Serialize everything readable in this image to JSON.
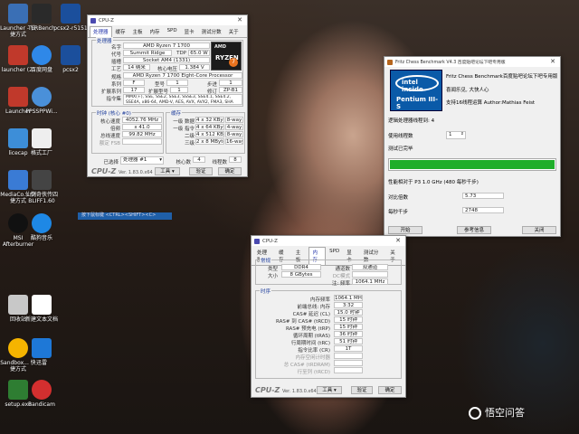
{
  "desktop": {
    "icons": [
      {
        "label": "Launcher - 快捷方式",
        "color": "#3a6fb5"
      },
      {
        "label": "TLRBench",
        "color": "#2a2a2a"
      },
      {
        "label": "pcsx2-r5151",
        "color": "#1b4f9c"
      },
      {
        "label": "launcher (2)",
        "color": "#c0392b"
      },
      {
        "label": "百度网盘",
        "color": "#2f88e8"
      },
      {
        "label": "pcsx2",
        "color": "#1b4f9c"
      },
      {
        "label": "Launcher",
        "color": "#c0392b"
      },
      {
        "label": "PPSSPPWi...",
        "color": "#4a90d9"
      },
      {
        "label": "licecap",
        "color": "#3d8ed8"
      },
      {
        "label": "格式工厂",
        "color": "#eeeeee"
      },
      {
        "label": "MediaCo... 快捷方式",
        "color": "#3a7bd5"
      },
      {
        "label": "仙剑奇侠传四 BLIFF1.60",
        "color": "#444"
      },
      {
        "label": "MSI Afterburner",
        "color": "#111"
      },
      {
        "label": "酷狗音乐",
        "color": "#1e88e5"
      },
      {
        "label": "回收站",
        "color": "#c8c8c8"
      },
      {
        "label": "新建文本文档",
        "color": "#ffffff"
      },
      {
        "label": "Sandbox... 快捷方式",
        "color": "#f5b400"
      },
      {
        "label": "迅雷",
        "color": "#1e78d7"
      },
      {
        "label": "setup.exe",
        "color": "#2e7d32"
      },
      {
        "label": "Bandicam",
        "color": "#d32f2f"
      }
    ]
  },
  "hint_bar": "按下鼠标键 <CTRL><SHIFT><C>",
  "watermark": "悟空问答",
  "cpuz1": {
    "title": "CPU-Z",
    "tabs": [
      "处理器",
      "缓存",
      "主板",
      "内存",
      "SPD",
      "显卡",
      "测试分数",
      "关于"
    ],
    "group_processor": "处理器",
    "name_label": "名字",
    "name": "AMD Ryzen 7 1700",
    "code_label": "代号",
    "code": "Summit Ridge",
    "tdp_label": "TDP",
    "tdp": "65.0 W",
    "socket_label": "插槽",
    "socket": "Socket AM4 (1331)",
    "tech_label": "工艺",
    "tech": "14 纳米",
    "vcore_label": "核心电压",
    "vcore": "1.384 V",
    "spec_label": "规格",
    "spec": "AMD Ryzen 7 1700 Eight-Core Processor",
    "family_label": "系列",
    "family": "F",
    "model_label": "型号",
    "model": "1",
    "stepping_label": "步进",
    "stepping": "1",
    "extfamily_label": "扩展系列",
    "extfamily": "17",
    "extmodel_label": "扩展型号",
    "extmodel": "1",
    "revision_label": "修订",
    "revision": "ZP-B1",
    "instr_label": "指令集",
    "instr": "MMX(+), SSE, SSE2, SSE3, SSSE3, SSE4.1, SSE4.2, SSE4A, x86-64, AMD-V, AES, AVX, AVX2, FMA3, SHA",
    "group_clocks": "时钟 (核心 #0)",
    "corespeed_label": "核心速度",
    "corespeed": "4052.76 MHz",
    "mult_label": "倍频",
    "mult": "x 41.0",
    "bus_label": "总线速度",
    "bus": "99.82 MHz",
    "fsb_label": "额定 FSB",
    "fsb": "",
    "group_cache": "缓存",
    "cache": [
      {
        "label": "一级 数据",
        "size": "4 x 32 KBytes",
        "way": "8-way"
      },
      {
        "label": "一级 指令",
        "size": "4 x 64 KBytes",
        "way": "4-way"
      },
      {
        "label": "二级",
        "size": "4 x 512 KBytes",
        "way": "8-way"
      },
      {
        "label": "三级",
        "size": "2 x 8 MBytes",
        "way": "16-way"
      }
    ],
    "selected_label": "已选择",
    "selected": "处理器 #1",
    "cores_label": "核心数",
    "cores": "4",
    "threads_label": "线程数",
    "threads": "8",
    "logo": "CPU-Z",
    "version": "Ver. 1.83.0.x64",
    "tools": "工具",
    "validate": "验证",
    "ok": "确定",
    "brand_amd": "AMD",
    "brand_ryzen": "RYZEN",
    "brand_num": "7"
  },
  "fritz": {
    "title": "Fritz Chess Benchmark V4.3   百度贴吧论坛下吧专用版",
    "header_line1": "Fritz Chess Benchmark百度贴吧论坛下吧专用版",
    "header_line2": "喜闻乐见, 大快人心",
    "header_line3": "支持16线程运算     Author:Mathias Feist",
    "intel_inside": "intel inside",
    "intel_model": "Pentium III-S",
    "threads_label": "逻辑处理器线程到: 4",
    "use_threads_label": "使用线程数",
    "use_threads_value": "1",
    "test_done": "测试已完毕",
    "progress": 1.0,
    "progress_color": "#1fae2a",
    "perf_label": "性能相对于 P3 1.0 GHz (480 每秒千步)",
    "ratio_label": "对比倍数",
    "ratio": "5.73",
    "kn_label": "每秒千步",
    "kn": "2748",
    "start": "开始",
    "reference": "参考信息",
    "close": "关闭"
  },
  "cpuz2": {
    "title": "CPU-Z",
    "tabs": [
      "处理器",
      "缓存",
      "主板",
      "内存",
      "SPD",
      "显卡",
      "测试分数",
      "关于"
    ],
    "group_general": "常规",
    "type_label": "类型",
    "type": "DDR4",
    "channel_label": "通道数",
    "channel": "双通道",
    "size_label": "大小",
    "size": "8 GBytes",
    "dc_label": "DC模式",
    "dc": "",
    "nb_label": "注: 频率",
    "nb": "1064.1 MHz",
    "group_timings": "时序",
    "timings": [
      {
        "label": "内存频率",
        "value": "1064.1 MHz"
      },
      {
        "label": "前端总线: 内存",
        "value": "3:32"
      },
      {
        "label": "CAS# 延迟 (CL)",
        "value": "15.0 时钟"
      },
      {
        "label": "RAS# 到 CAS# (tRCD)",
        "value": "15 时钟"
      },
      {
        "label": "RAS# 预充电 (tRP)",
        "value": "15 时钟"
      },
      {
        "label": "循环周期 (tRAS)",
        "value": "36 时钟"
      },
      {
        "label": "行周期时间 (tRC)",
        "value": "51 时钟"
      },
      {
        "label": "指令比率 (CR)",
        "value": "1T"
      },
      {
        "label": "内存空闲计时器",
        "value": ""
      },
      {
        "label": "总 CAS# (tRDRAM)",
        "value": ""
      },
      {
        "label": "行至列 (tRCD)",
        "value": ""
      }
    ],
    "logo": "CPU-Z",
    "version": "Ver. 1.83.0.x64",
    "tools": "工具",
    "validate": "验证",
    "ok": "确定"
  }
}
